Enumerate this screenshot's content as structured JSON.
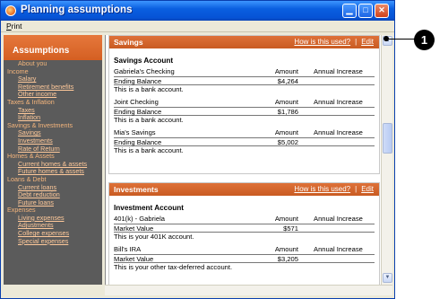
{
  "window": {
    "title": "Planning assumptions"
  },
  "menu": {
    "print": "Print"
  },
  "sidebar": {
    "header": "Assumptions",
    "items": [
      {
        "label": "About you",
        "kind": "first"
      },
      {
        "label": "Income",
        "kind": "cat"
      },
      {
        "label": "Salary",
        "kind": "sub"
      },
      {
        "label": "Retirement benefits",
        "kind": "sub"
      },
      {
        "label": "Other income",
        "kind": "sub"
      },
      {
        "label": "Taxes & Inflation",
        "kind": "cat"
      },
      {
        "label": "Taxes",
        "kind": "sub"
      },
      {
        "label": "Inflation",
        "kind": "sub"
      },
      {
        "label": "Savings & Investments",
        "kind": "cat"
      },
      {
        "label": "Savings",
        "kind": "sub"
      },
      {
        "label": "Investments",
        "kind": "sub"
      },
      {
        "label": "Rate of Return",
        "kind": "sub"
      },
      {
        "label": "Homes & Assets",
        "kind": "cat"
      },
      {
        "label": "Current homes & assets",
        "kind": "sub"
      },
      {
        "label": "Future homes & assets",
        "kind": "sub"
      },
      {
        "label": "Loans & Debt",
        "kind": "cat"
      },
      {
        "label": "Current loans",
        "kind": "sub"
      },
      {
        "label": "Debt reduction",
        "kind": "sub"
      },
      {
        "label": "Future loans",
        "kind": "sub"
      },
      {
        "label": "Expenses",
        "kind": "cat"
      },
      {
        "label": "Living expenses",
        "kind": "sub"
      },
      {
        "label": "Adjustments",
        "kind": "sub"
      },
      {
        "label": "College expenses",
        "kind": "sub"
      },
      {
        "label": "Special expenses",
        "kind": "sub"
      }
    ]
  },
  "sections": {
    "savings": {
      "title": "Savings",
      "how_link": "How is this used?",
      "sep": "|",
      "edit_link": "Edit",
      "group_title": "Savings Account",
      "accounts": [
        {
          "name": "Gabriela's Checking",
          "amount_header": "Amount",
          "increase_header": "Annual Increase",
          "value_label": "Ending Balance",
          "value": "$4,264",
          "desc": "This is a bank account."
        },
        {
          "name": "Joint Checking",
          "amount_header": "Amount",
          "increase_header": "Annual Increase",
          "value_label": "Ending Balance",
          "value": "$1,786",
          "desc": "This is a bank account."
        },
        {
          "name": "Mia's Savings",
          "amount_header": "Amount",
          "increase_header": "Annual Increase",
          "value_label": "Ending Balance",
          "value": "$5,002",
          "desc": "This is a bank account."
        }
      ]
    },
    "investments": {
      "title": "Investments",
      "how_link": "How is this used?",
      "sep": "|",
      "edit_link": "Edit",
      "group_title": "Investment Account",
      "accounts": [
        {
          "name": "401(k) - Gabriela",
          "amount_header": "Amount",
          "increase_header": "Annual Increase",
          "value_label": "Market Value",
          "value": "$571",
          "desc": "This is your 401K account."
        },
        {
          "name": "Bill's IRA",
          "amount_header": "Amount",
          "increase_header": "Annual Increase",
          "value_label": "Market Value",
          "value": "$3,205",
          "desc": "This is your other tax-deferred account."
        }
      ]
    }
  },
  "callout": {
    "number": "1"
  },
  "colors": {
    "accent": "#d4622a",
    "sidebar_bg": "#5b5b5b",
    "titlebar": "#0a5fe0"
  }
}
